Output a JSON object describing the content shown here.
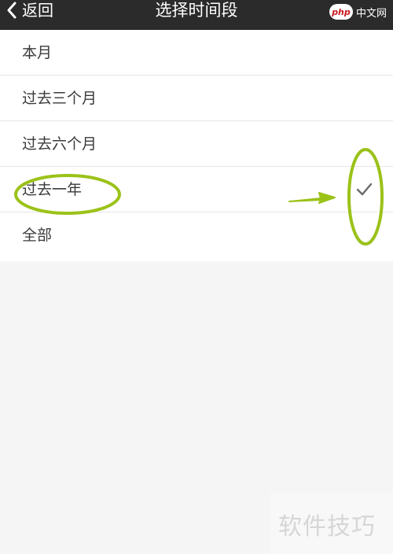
{
  "nav": {
    "back_label": "返回",
    "title": "选择时间段",
    "brand_logo": "php",
    "brand_text": "中文网"
  },
  "options": [
    {
      "label": "本月",
      "selected": false
    },
    {
      "label": "过去三个月",
      "selected": false
    },
    {
      "label": "过去六个月",
      "selected": false
    },
    {
      "label": "过去一年",
      "selected": true
    },
    {
      "label": "全部",
      "selected": false
    }
  ],
  "watermark": "软件技巧",
  "colors": {
    "nav_bg": "#2b2b2b",
    "annotation_green": "#9bc219",
    "check": "#6a6a6a"
  }
}
